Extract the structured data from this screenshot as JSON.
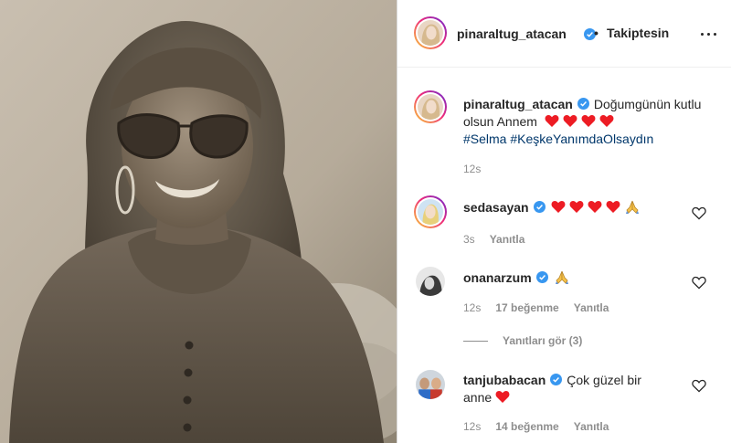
{
  "header": {
    "username": "pinaraltug_atacan",
    "separator": "•",
    "follow_state": "Takiptesin",
    "more_icon": "more-horizontal-icon"
  },
  "caption": {
    "username": "pinaraltug_atacan",
    "text": "Doğumgünün kutlu olsun Annem",
    "hashtags": [
      "#Selma",
      "#KeşkeYanımdaOlsaydın"
    ],
    "time": "12s"
  },
  "comments": [
    {
      "username": "sedasayan",
      "emojis": [
        "heart",
        "heart",
        "heart",
        "heart",
        "pray"
      ],
      "time": "3s",
      "likes": "",
      "reply": "Yanıtla"
    },
    {
      "username": "onanarzum",
      "emojis": [
        "pray"
      ],
      "time": "12s",
      "likes": "17 beğenme",
      "reply": "Yanıtla"
    },
    {
      "username": "tanjubabacan",
      "text_line1": "Çok güzel bir",
      "text_line2": "anne",
      "emojis": [
        "heart"
      ],
      "time": "12s",
      "likes": "14 beğenme",
      "reply": "Yanıtla"
    }
  ],
  "view_replies": "Yanıtları gör (3)",
  "colors": {
    "heart": "#ed1c24",
    "verified": "#3897f0",
    "link": "#00376b",
    "muted": "#8e8e8e"
  }
}
